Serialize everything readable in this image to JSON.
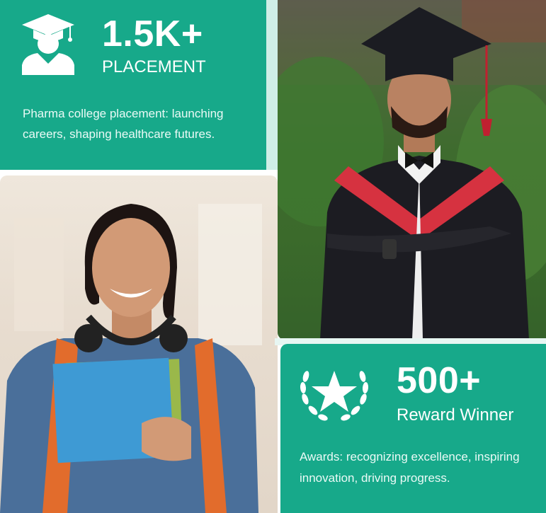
{
  "placement": {
    "number": "1.5K+",
    "label": "PLACEMENT",
    "description_line1": "Pharma college placement: launching",
    "description_line2": "careers, shaping healthcare futures.",
    "icon": "graduate-icon"
  },
  "reward": {
    "number": "500+",
    "label": "Reward Winner",
    "description_line1": "Awards: recognizing excellence, inspiring",
    "description_line2": "innovation, driving progress.",
    "icon": "laurel-star-icon"
  },
  "colors": {
    "accent": "#17a98a",
    "text_on_accent": "#ffffff"
  }
}
